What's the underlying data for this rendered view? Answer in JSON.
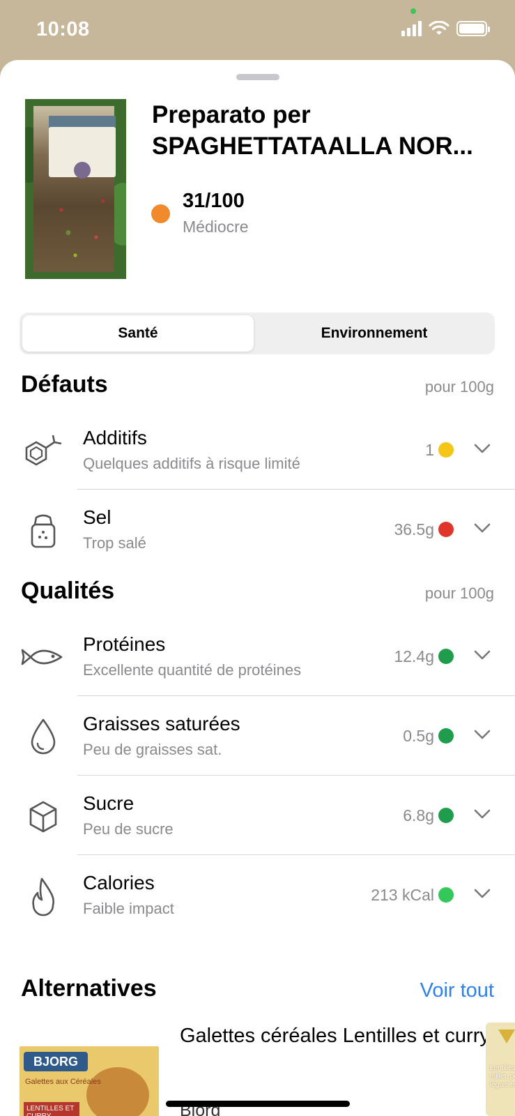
{
  "status": {
    "time": "10:08"
  },
  "product": {
    "title": "Preparato per SPAGHETTATAALLA NOR...",
    "score": "31/100",
    "score_label": "Médiocre",
    "score_color": "#f08a2c"
  },
  "tabs": [
    {
      "label": "Santé",
      "active": true
    },
    {
      "label": "Environnement",
      "active": false
    }
  ],
  "defauts": {
    "title": "Défauts",
    "unit": "pour 100g",
    "items": [
      {
        "icon": "molecule-icon",
        "title": "Additifs",
        "subtitle": "Quelques additifs à risque limité",
        "value": "1",
        "color": "#f5c518"
      },
      {
        "icon": "salt-shaker-icon",
        "title": "Sel",
        "subtitle": "Trop salé",
        "value": "36.5g",
        "color": "#e0352b"
      }
    ]
  },
  "qualites": {
    "title": "Qualités",
    "unit": "pour 100g",
    "items": [
      {
        "icon": "fish-icon",
        "title": "Protéines",
        "subtitle": "Excellente quantité de protéines",
        "value": "12.4g",
        "color": "#1f9d4d"
      },
      {
        "icon": "drop-icon",
        "title": "Graisses saturées",
        "subtitle": "Peu de graisses sat.",
        "value": "0.5g",
        "color": "#1f9d4d"
      },
      {
        "icon": "sugar-cube-icon",
        "title": "Sucre",
        "subtitle": "Peu de sucre",
        "value": "6.8g",
        "color": "#1f9d4d"
      },
      {
        "icon": "flame-icon",
        "title": "Calories",
        "subtitle": "Faible impact",
        "value": "213 kCal",
        "color": "#34c759"
      }
    ]
  },
  "alternatives": {
    "title": "Alternatives",
    "see_all": "Voir tout",
    "first": {
      "title": "Galettes céréales Lentilles et curry",
      "brand": "Bjorg",
      "img_logo": "BJORG",
      "img_text": "Galettes aux Céréales",
      "img_band": "LENTILLES ET CURRY"
    },
    "second": {
      "img_text": "Lentilles millet, petits légumes"
    }
  }
}
